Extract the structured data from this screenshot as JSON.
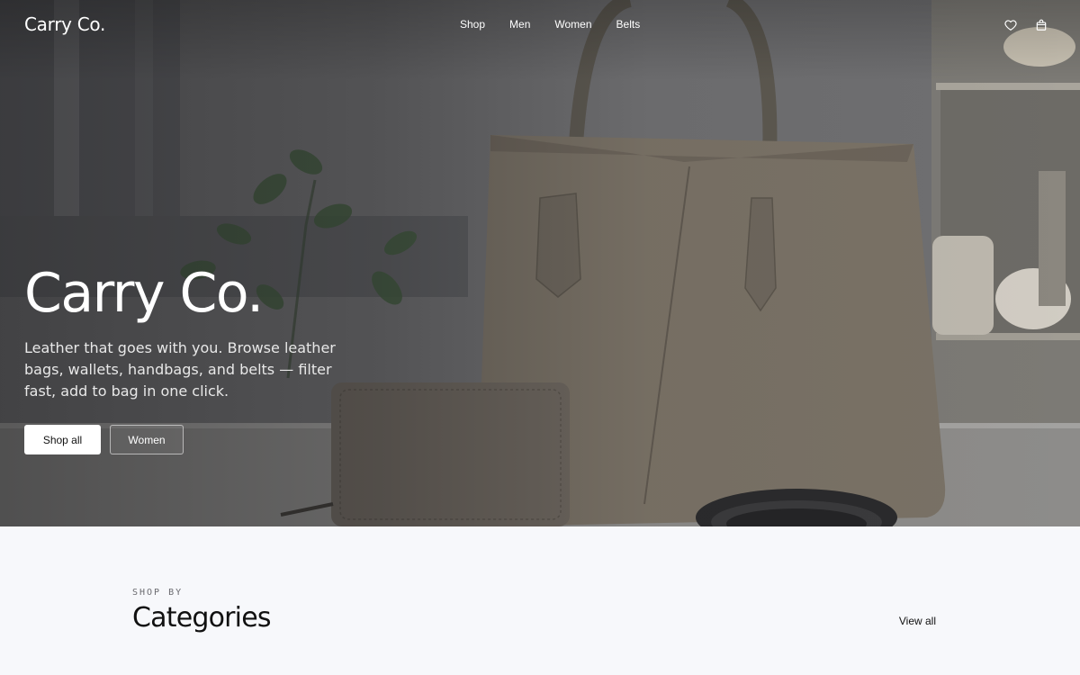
{
  "brand": {
    "name": "Carry Co."
  },
  "nav": {
    "links": [
      "Shop",
      "Men",
      "Women",
      "Belts"
    ],
    "icons": [
      "heart-icon",
      "bag-icon"
    ]
  },
  "hero": {
    "title": "Carry Co.",
    "description": "Leather that goes with you. Browse leather bags, wallets, handbags, and belts — filter fast, add to bag in one click.",
    "primary_cta": "Shop all",
    "secondary_cta": "Women"
  },
  "section": {
    "eyebrow": "SHOP BY",
    "title": "Categories",
    "view_all": "View all"
  },
  "colors": {
    "accent": "#ffffff",
    "background": "#f7f8fb",
    "text": "#111111"
  }
}
